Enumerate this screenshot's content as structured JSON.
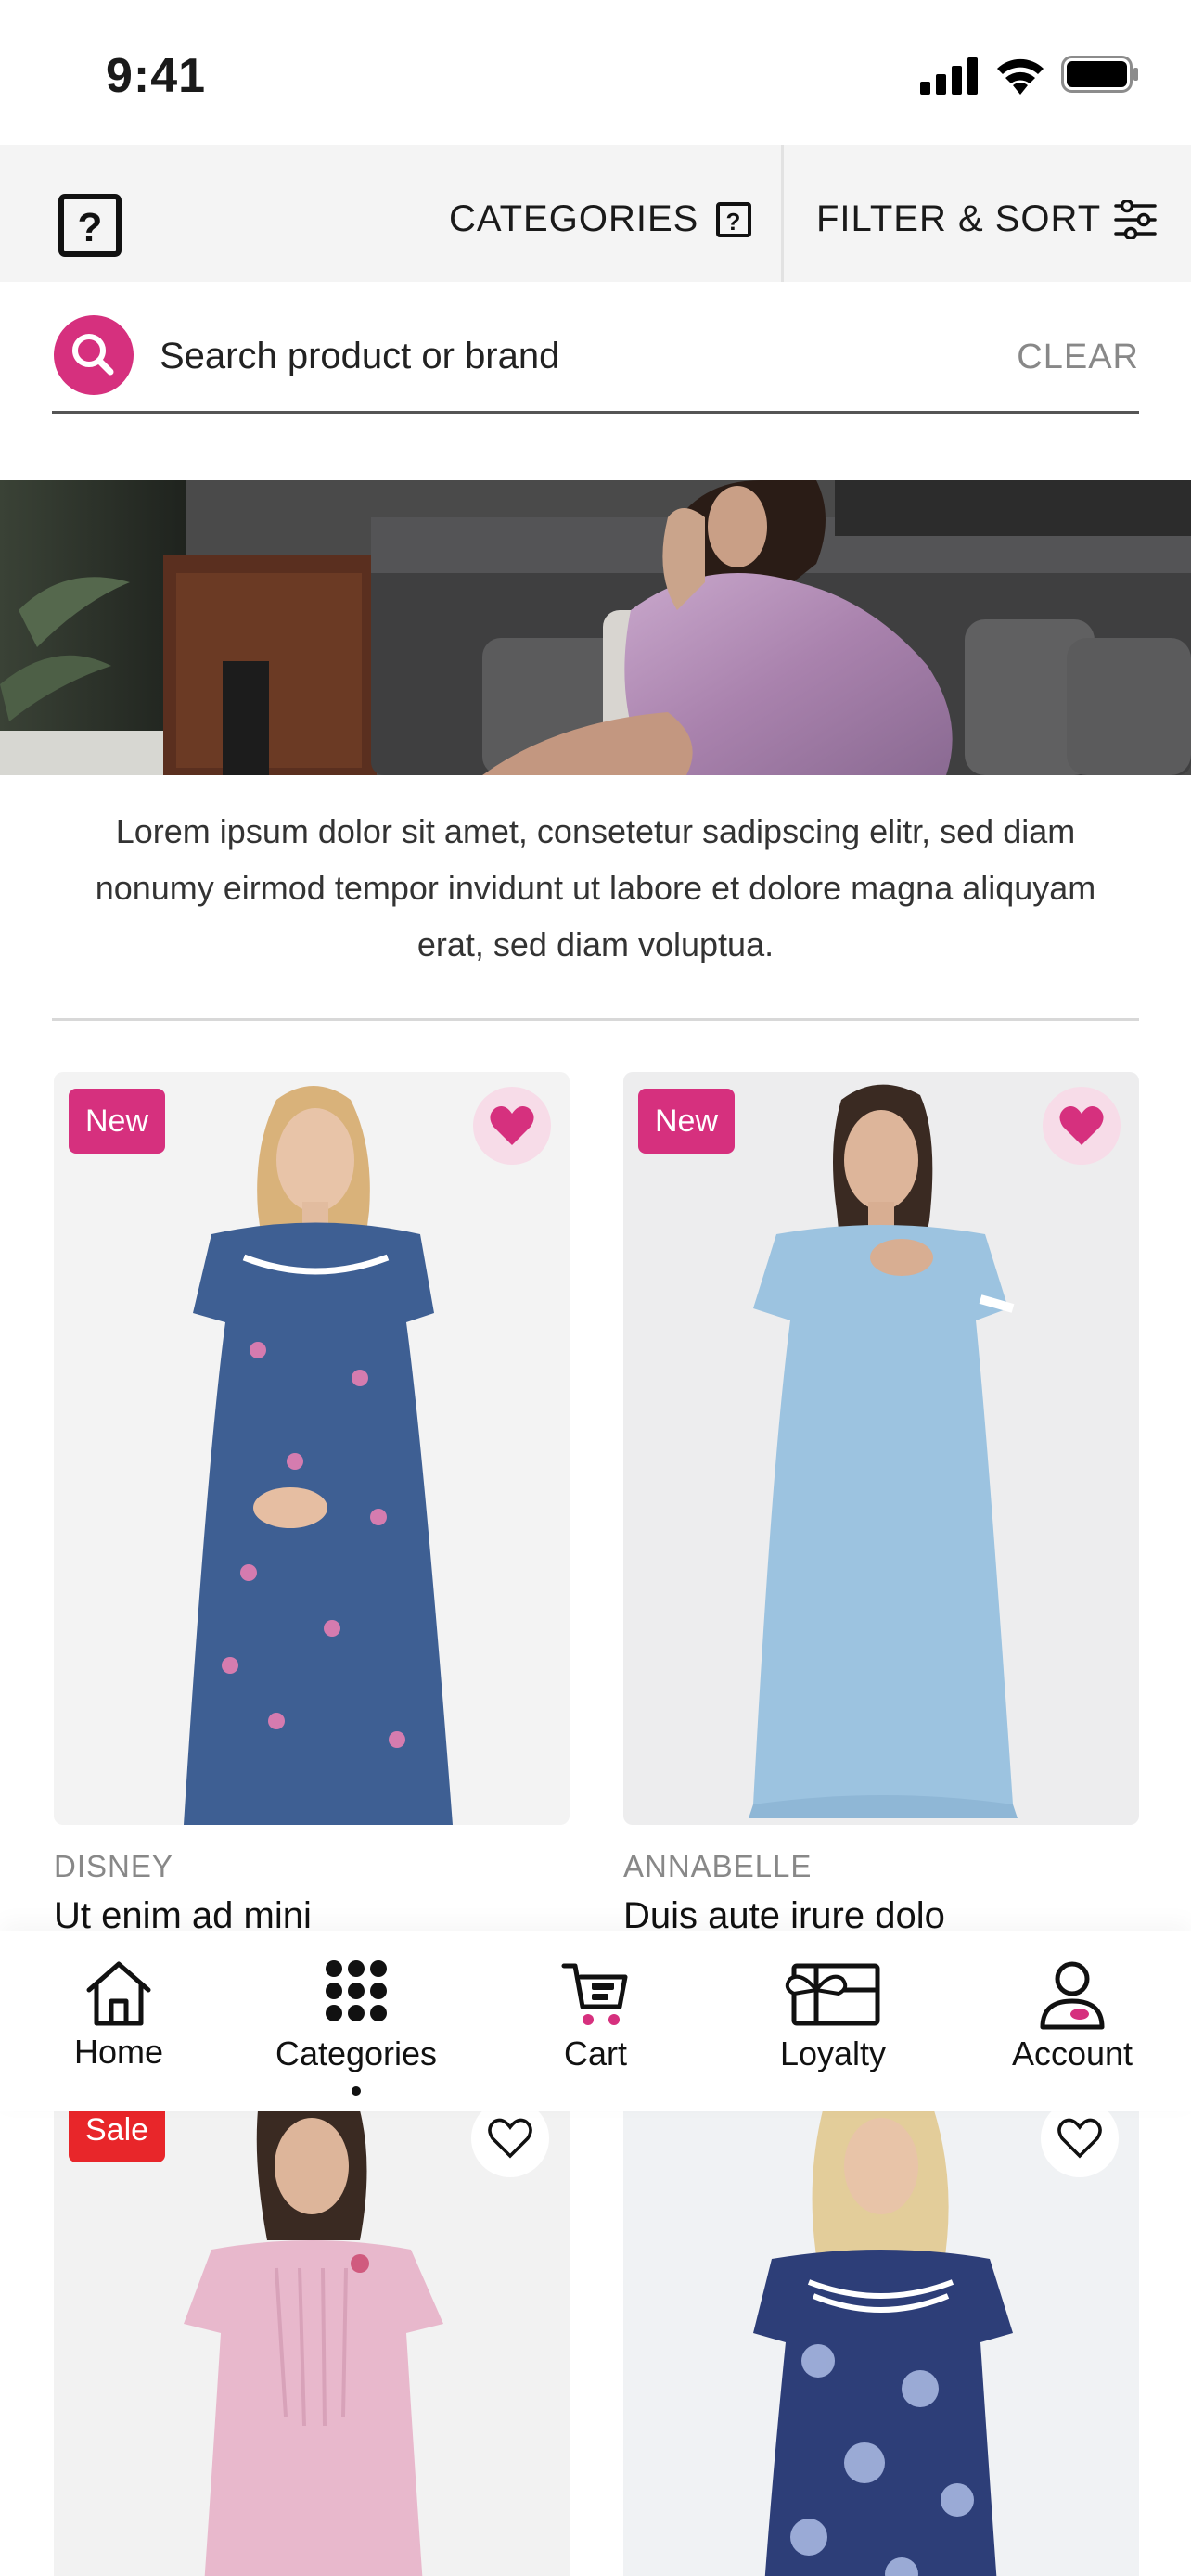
{
  "status_bar": {
    "time": "9:41"
  },
  "top_bar": {
    "categories_label": "CATEGORIES",
    "filter_label": "FILTER & SORT"
  },
  "search": {
    "placeholder": "Search product or brand",
    "clear_label": "CLEAR"
  },
  "banner": {
    "description": "Lorem ipsum dolor sit amet, consetetur sadipscing elitr, sed diam nonumy eirmod tempor invidunt ut labore et dolore magna aliquyam erat, sed diam voluptua."
  },
  "products": [
    {
      "badge": "New",
      "brand": "DISNEY",
      "name": "Ut enim ad mini",
      "favorited": true,
      "dress_color": "#3e5f93"
    },
    {
      "badge": "New",
      "brand": "ANNABELLE",
      "name": "Duis aute irure dolo",
      "favorited": true,
      "dress_color": "#9cc3e0"
    },
    {
      "badge": "Sale",
      "brand": "",
      "name": "",
      "favorited": false,
      "dress_color": "#e8b8cc"
    },
    {
      "badge": "",
      "brand": "",
      "name": "",
      "favorited": false,
      "dress_color": "#2d3e78"
    }
  ],
  "colors": {
    "accent": "#d6307e",
    "sale": "#e8262a"
  },
  "bottom_nav": {
    "home": "Home",
    "categories": "Categories",
    "cart": "Cart",
    "loyalty": "Loyalty",
    "account": "Account",
    "active": "categories"
  }
}
